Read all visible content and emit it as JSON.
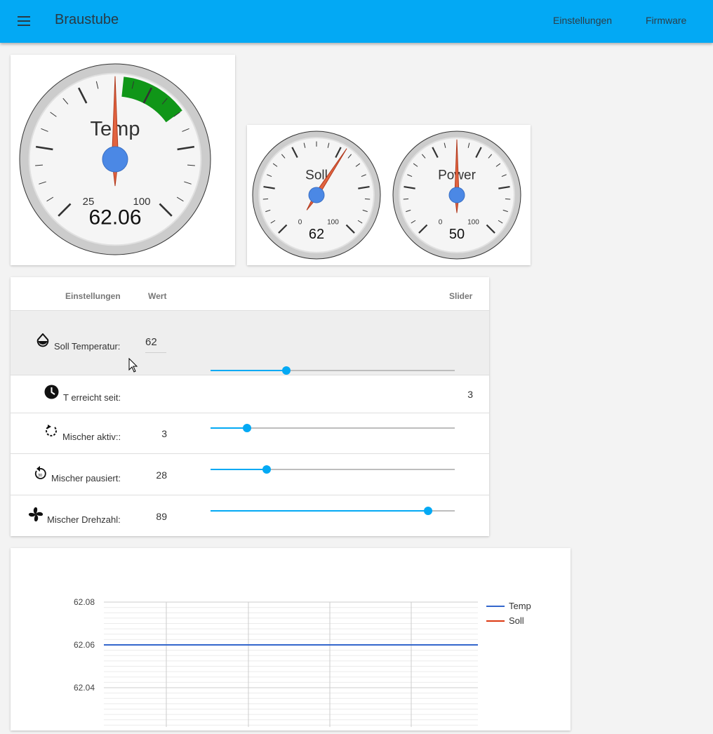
{
  "header": {
    "title": "Braustube",
    "menu_icon": "menu-icon",
    "nav": [
      "Einstellungen",
      "Firmware"
    ],
    "color": "#03a9f4"
  },
  "gauges": [
    {
      "label": "Temp",
      "value": "62.06",
      "min_label": "25",
      "max_label": "100",
      "band_color": "#109618"
    },
    {
      "label": "Soll",
      "value": "62",
      "min_label": "0",
      "max_label": "100"
    },
    {
      "label": "Power",
      "value": "50",
      "min_label": "0",
      "max_label": "100"
    }
  ],
  "settings": {
    "headers": {
      "settings": "Einstellungen",
      "value": "Wert",
      "slider": "Slider"
    },
    "rows": [
      {
        "label": "Soll Temperatur:",
        "value": "62",
        "icon": "water-drop-icon",
        "slider_percent": 31
      },
      {
        "label": "T erreicht seit:",
        "value": "3",
        "icon": "clock-icon"
      },
      {
        "label": "Mischer aktiv::",
        "value": "3",
        "icon": "rotate-icon",
        "slider_percent": 15
      },
      {
        "label": "Mischer pausiert:",
        "value": "28",
        "icon": "replay-30-icon",
        "slider_percent": 23
      },
      {
        "label": "Mischer Drehzahl:",
        "value": "89",
        "icon": "fan-icon",
        "slider_percent": 89
      }
    ]
  },
  "chart_data": {
    "type": "line",
    "y_ticks": [
      "62.08",
      "62.06",
      "62.04"
    ],
    "ylim": [
      62.02,
      62.09
    ],
    "series": [
      {
        "name": "Temp",
        "color": "#3366cc",
        "values": [
          62.06,
          62.06
        ]
      },
      {
        "name": "Soll",
        "color": "#dc3912",
        "values": []
      }
    ],
    "grid": true,
    "legend": "right"
  }
}
